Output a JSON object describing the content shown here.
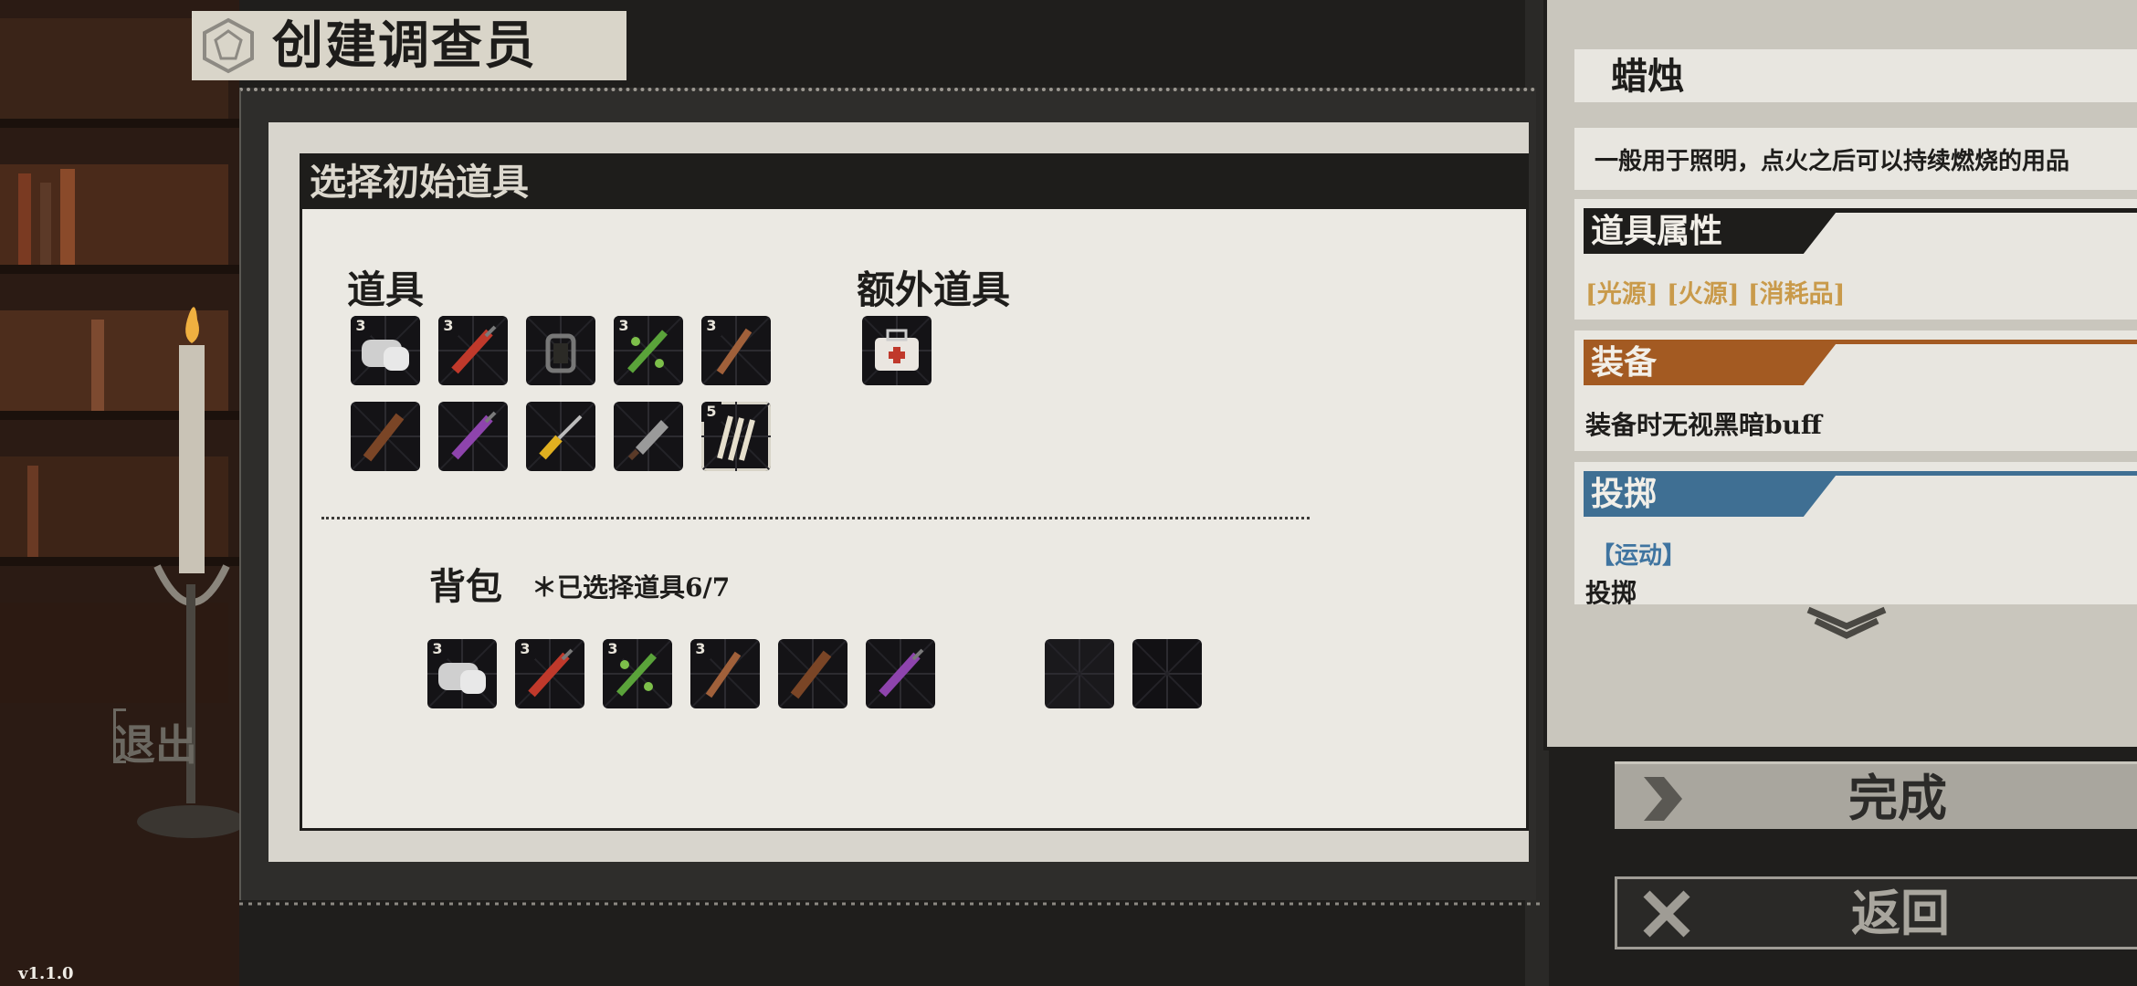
{
  "header": {
    "title": "创建调查员"
  },
  "selection": {
    "title": "选择初始道具",
    "items_label": "道具",
    "extra_items_label": "额外道具",
    "bag_label": "背包",
    "bag_count": "＊已选择道具6/7",
    "items": [
      {
        "icon": "bandage-icon",
        "badge": "3"
      },
      {
        "icon": "red-syringe-icon",
        "badge": "3"
      },
      {
        "icon": "lantern-icon",
        "badge": ""
      },
      {
        "icon": "green-syringe-icon",
        "badge": "3"
      },
      {
        "icon": "torch-icon",
        "badge": "3"
      },
      {
        "icon": "wooden-club-icon",
        "badge": ""
      },
      {
        "icon": "purple-syringe-icon",
        "badge": ""
      },
      {
        "icon": "screwdriver-icon",
        "badge": ""
      },
      {
        "icon": "cleaver-icon",
        "badge": ""
      },
      {
        "icon": "candles-icon",
        "badge": "5",
        "selected": true
      }
    ],
    "extra_items": [
      {
        "icon": "first-aid-kit-icon",
        "badge": ""
      }
    ],
    "bag_items": [
      {
        "icon": "bandage-icon",
        "badge": "3"
      },
      {
        "icon": "red-syringe-icon",
        "badge": "3"
      },
      {
        "icon": "green-syringe-icon",
        "badge": "3"
      },
      {
        "icon": "torch-icon",
        "badge": "3"
      },
      {
        "icon": "wooden-club-icon",
        "badge": ""
      },
      {
        "icon": "purple-syringe-icon",
        "badge": ""
      }
    ]
  },
  "detail": {
    "item_name": "蜡烛",
    "description": "一般用于照明，点火之后可以持续燃烧的用品",
    "properties_title": "道具属性",
    "properties_tags": "[光源] [火源] [消耗品]",
    "equip_title": "装备",
    "equip_text": "装备时无视黑暗buff",
    "throw_title": "投掷",
    "throw_tag": "【运动】",
    "throw_text": "投掷"
  },
  "buttons": {
    "done": "完成",
    "back": "返回"
  },
  "exit_label": "退出",
  "version": "v1.1.0",
  "colors": {
    "equip": "#a35a22",
    "throw": "#3f6f93",
    "properties": "#1e1d1b",
    "tag": "#c99a4a"
  }
}
